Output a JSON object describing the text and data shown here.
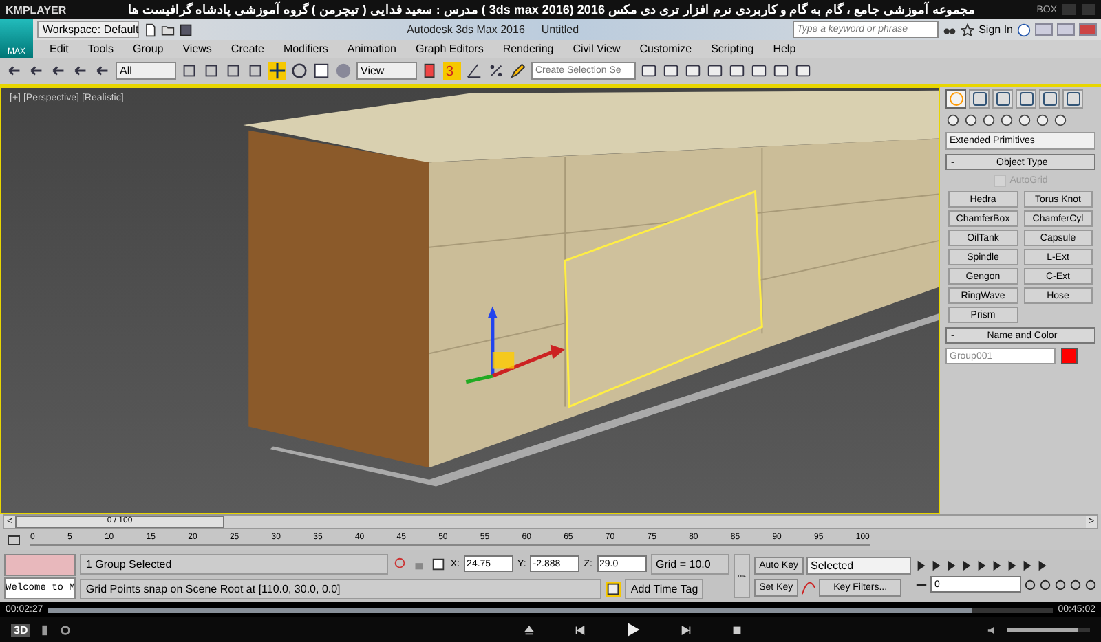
{
  "player": {
    "app_name": "KMPLAYER",
    "title": "مجموعه آموزشی جامع ، گام به گام و کاربردی نرم افزار تری دی مکس 2016  (3ds max 2016 )  مدرس : سعید فدایی ( تیچرمن ) گروه آموزشی پادشاه گرافیست ها",
    "box_label": "BOX"
  },
  "max_title": {
    "logo": "MAX",
    "workspace": "Workspace: Default",
    "title": "Autodesk 3ds Max 2016",
    "file": "Untitled",
    "search_placeholder": "Type a keyword or phrase",
    "sign_in": "Sign In"
  },
  "menu": [
    "Edit",
    "Tools",
    "Group",
    "Views",
    "Create",
    "Modifiers",
    "Animation",
    "Graph Editors",
    "Rendering",
    "Civil View",
    "Customize",
    "Scripting",
    "Help"
  ],
  "toolbar": {
    "selection_filter": "All",
    "reference_coord": "View",
    "snap_label": "3",
    "selection_set_placeholder": "Create Selection Se"
  },
  "viewport": {
    "labels": [
      "[+]",
      "[Perspective]",
      "[Realistic]"
    ]
  },
  "command_panel": {
    "tabs": [
      {
        "selected": true
      },
      {
        "selected": false
      },
      {
        "selected": false
      },
      {
        "selected": false
      },
      {
        "selected": false
      },
      {
        "selected": false
      }
    ],
    "category": "Extended Primitives",
    "object_type": {
      "title": "Object Type",
      "collapse": "-",
      "autogrid": {
        "label": "AutoGrid",
        "checked": false,
        "disabled": true
      },
      "buttons": [
        "Hedra",
        "Torus Knot",
        "ChamferBox",
        "ChamferCyl",
        "OilTank",
        "Capsule",
        "Spindle",
        "L-Ext",
        "Gengon",
        "C-Ext",
        "RingWave",
        "Hose",
        "Prism"
      ]
    },
    "name_and_color": {
      "title": "Name and Color",
      "collapse": "-",
      "name": "Group001",
      "color": "#ff0000"
    }
  },
  "timeline": {
    "frame_label": "0 / 100",
    "prev": "<",
    "next": ">",
    "level": 0,
    "ticks": [
      "0",
      "5",
      "10",
      "15",
      "20",
      "25",
      "30",
      "35",
      "40",
      "45",
      "50",
      "55",
      "60",
      "65",
      "70",
      "75",
      "80",
      "85",
      "90",
      "95",
      "100"
    ]
  },
  "status": {
    "listener": "Welcome to M",
    "selection": "1 Group Selected",
    "prompt": "Grid Points snap on Scene Root at [110.0, 30.0, 0.0]",
    "coords": [
      {
        "label": "X:",
        "value": "24.75"
      },
      {
        "label": "Y:",
        "value": "-2.888"
      },
      {
        "label": "Z:",
        "value": "29.0"
      }
    ],
    "grid": "Grid = 10.0",
    "add_time_tag": "Add Time Tag",
    "auto_key": "Auto Key",
    "set_key": "Set Key",
    "key_mode": "Selected",
    "key_filters": "Key Filters...",
    "frame": "0"
  },
  "playback": {
    "elapsed": "00:02:27",
    "total": "00:45:02",
    "level": 0.92,
    "badge": "3D",
    "volume": {
      "level": 0.85
    }
  }
}
